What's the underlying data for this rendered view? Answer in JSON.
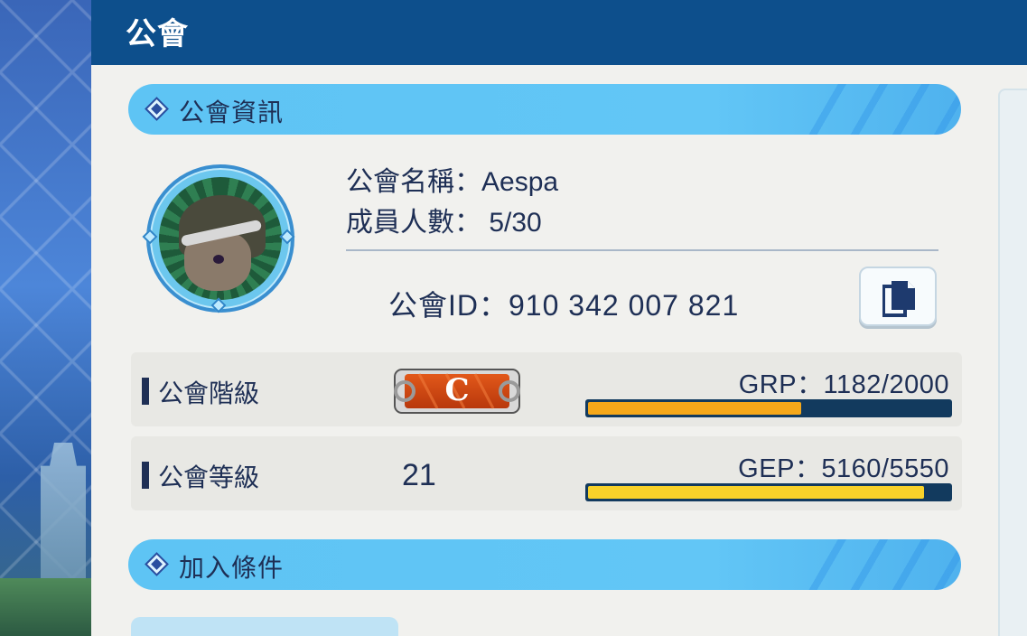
{
  "header": {
    "title": "公會"
  },
  "sections": {
    "info": {
      "title": "公會資訊"
    },
    "join": {
      "title": "加入條件"
    }
  },
  "guild": {
    "name_line": "公會名稱：Aespa",
    "members_line": "成員人數： 5/30",
    "id_line": "公會ID：910 342 007 821",
    "copy_icon": "copy-icon"
  },
  "stats": {
    "rank": {
      "label": "公會階級",
      "badge_letter": "C",
      "progress_text": "GRP：1182/2000",
      "progress_current": 1182,
      "progress_max": 2000,
      "bar_color": "#f5a81a"
    },
    "level": {
      "label": "公會等級",
      "value": "21",
      "progress_text": "GEP：5160/5550",
      "progress_current": 5160,
      "progress_max": 5550,
      "bar_color": "#f8d22a"
    }
  },
  "join_chip": {
    "text": ""
  }
}
